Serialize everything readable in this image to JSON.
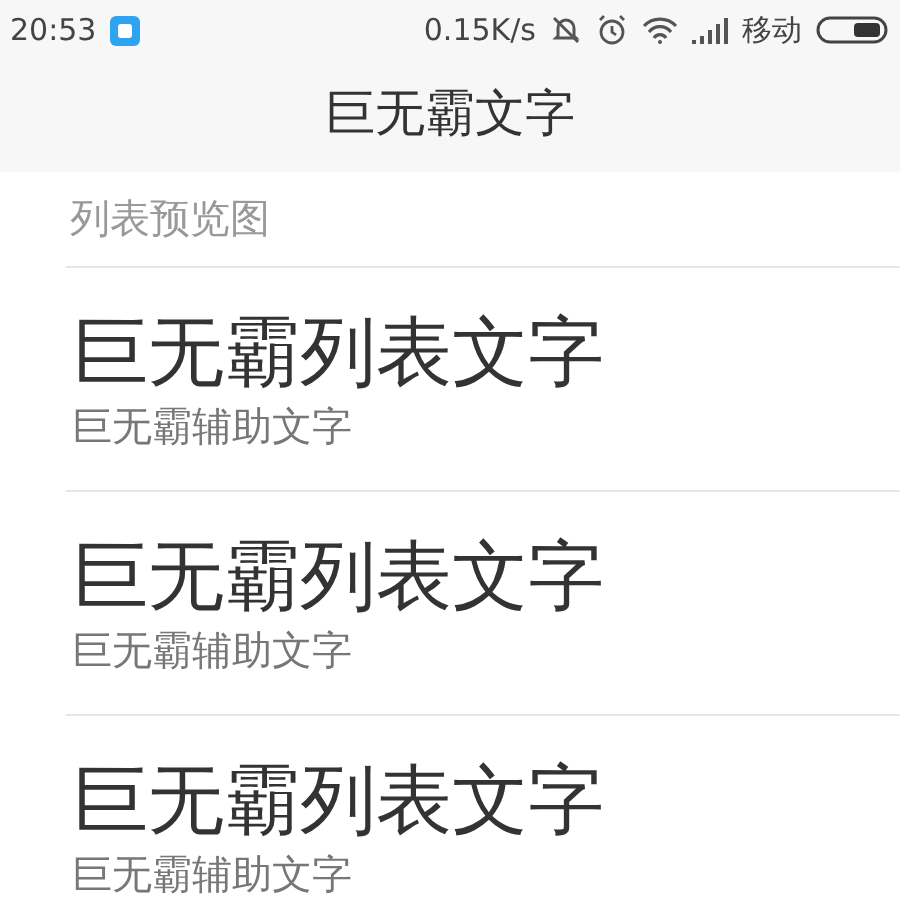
{
  "status_bar": {
    "time": "20:53",
    "speed": "0.15K/s",
    "carrier": "移动"
  },
  "title": "巨无霸文字",
  "section_header": "列表预览图",
  "items": [
    {
      "primary": "巨无霸列表文字",
      "secondary": "巨无霸辅助文字"
    },
    {
      "primary": "巨无霸列表文字",
      "secondary": "巨无霸辅助文字"
    },
    {
      "primary": "巨无霸列表文字",
      "secondary": "巨无霸辅助文字"
    }
  ]
}
